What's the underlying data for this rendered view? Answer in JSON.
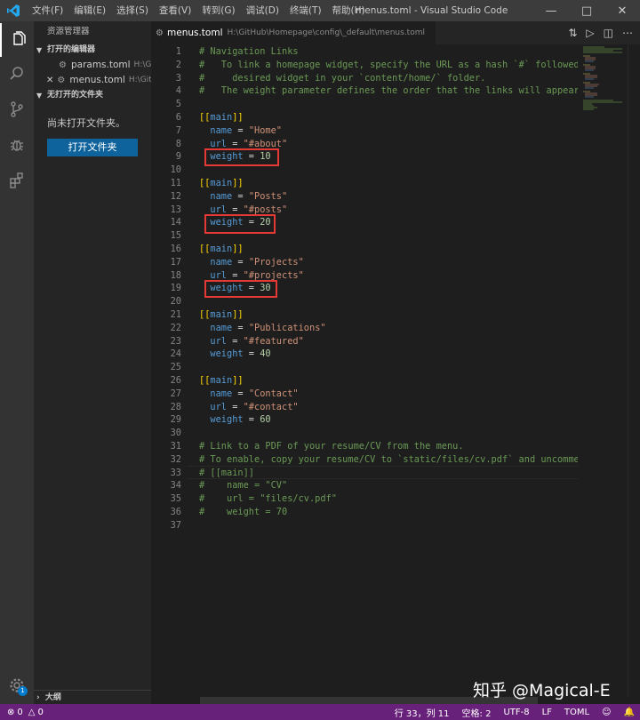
{
  "titlebar": {
    "menu": [
      "文件(F)",
      "编辑(E)",
      "选择(S)",
      "查看(V)",
      "转到(G)",
      "调试(D)",
      "终端(T)",
      "帮助(H)"
    ],
    "window_title": "menus.toml - Visual Studio Code"
  },
  "sidebar": {
    "title": "资源管理器",
    "open_editors_label": "打开的编辑器",
    "open_editors": [
      {
        "name": "params.toml",
        "path": "H:\\Gi..."
      },
      {
        "name": "menus.toml",
        "path": "H:\\Git..."
      }
    ],
    "no_folder_label": "无打开的文件夹",
    "no_folder_text": "尚未打开文件夹。",
    "open_folder_button": "打开文件夹",
    "outline_label": "大纲",
    "settings_badge": "1"
  },
  "editor": {
    "tab_name": "menus.toml",
    "tab_path": "H:\\GitHub\\Homepage\\config\\_default\\menus.toml",
    "lines": [
      {
        "n": "1",
        "tokens": [
          {
            "t": "# Navigation Links",
            "c": "comment"
          }
        ]
      },
      {
        "n": "2",
        "tokens": [
          {
            "t": "#   To link a homepage widget, specify the URL as a hash `#` followed b",
            "c": "comment"
          }
        ]
      },
      {
        "n": "3",
        "tokens": [
          {
            "t": "#     desired widget in your `content/home/` folder.",
            "c": "comment"
          }
        ]
      },
      {
        "n": "4",
        "tokens": [
          {
            "t": "#   The weight parameter defines the order that the links will appear i",
            "c": "comment"
          }
        ]
      },
      {
        "n": "5",
        "tokens": []
      },
      {
        "n": "6",
        "tokens": [
          {
            "t": "[[",
            "c": "bracket"
          },
          {
            "t": "main",
            "c": "key"
          },
          {
            "t": "]]",
            "c": "bracket"
          }
        ]
      },
      {
        "n": "7",
        "tokens": [
          {
            "t": "  name",
            "c": "key"
          },
          {
            "t": " = ",
            "c": "op"
          },
          {
            "t": "\"Home\"",
            "c": "str"
          }
        ]
      },
      {
        "n": "8",
        "tokens": [
          {
            "t": "  url",
            "c": "key"
          },
          {
            "t": " = ",
            "c": "op"
          },
          {
            "t": "\"#about\"",
            "c": "str"
          }
        ]
      },
      {
        "n": "9",
        "tokens": [
          {
            "t": "  weight",
            "c": "key"
          },
          {
            "t": " = ",
            "c": "op"
          },
          {
            "t": "10",
            "c": "num"
          }
        ]
      },
      {
        "n": "10",
        "tokens": []
      },
      {
        "n": "11",
        "tokens": [
          {
            "t": "[[",
            "c": "bracket"
          },
          {
            "t": "main",
            "c": "key"
          },
          {
            "t": "]]",
            "c": "bracket"
          }
        ]
      },
      {
        "n": "12",
        "tokens": [
          {
            "t": "  name",
            "c": "key"
          },
          {
            "t": " = ",
            "c": "op"
          },
          {
            "t": "\"Posts\"",
            "c": "str"
          }
        ]
      },
      {
        "n": "13",
        "tokens": [
          {
            "t": "  url",
            "c": "key"
          },
          {
            "t": " = ",
            "c": "op"
          },
          {
            "t": "\"#posts\"",
            "c": "str"
          }
        ]
      },
      {
        "n": "14",
        "tokens": [
          {
            "t": "  weight",
            "c": "key"
          },
          {
            "t": " = ",
            "c": "op"
          },
          {
            "t": "20",
            "c": "num"
          }
        ]
      },
      {
        "n": "15",
        "tokens": []
      },
      {
        "n": "16",
        "tokens": [
          {
            "t": "[[",
            "c": "bracket"
          },
          {
            "t": "main",
            "c": "key"
          },
          {
            "t": "]]",
            "c": "bracket"
          }
        ]
      },
      {
        "n": "17",
        "tokens": [
          {
            "t": "  name",
            "c": "key"
          },
          {
            "t": " = ",
            "c": "op"
          },
          {
            "t": "\"Projects\"",
            "c": "str"
          }
        ]
      },
      {
        "n": "18",
        "tokens": [
          {
            "t": "  url",
            "c": "key"
          },
          {
            "t": " = ",
            "c": "op"
          },
          {
            "t": "\"#projects\"",
            "c": "str"
          }
        ]
      },
      {
        "n": "19",
        "tokens": [
          {
            "t": "  weight",
            "c": "key"
          },
          {
            "t": " = ",
            "c": "op"
          },
          {
            "t": "30",
            "c": "num"
          }
        ]
      },
      {
        "n": "20",
        "tokens": []
      },
      {
        "n": "21",
        "tokens": [
          {
            "t": "[[",
            "c": "bracket"
          },
          {
            "t": "main",
            "c": "key"
          },
          {
            "t": "]]",
            "c": "bracket"
          }
        ]
      },
      {
        "n": "22",
        "tokens": [
          {
            "t": "  name",
            "c": "key"
          },
          {
            "t": " = ",
            "c": "op"
          },
          {
            "t": "\"Publications\"",
            "c": "str"
          }
        ]
      },
      {
        "n": "23",
        "tokens": [
          {
            "t": "  url",
            "c": "key"
          },
          {
            "t": " = ",
            "c": "op"
          },
          {
            "t": "\"#featured\"",
            "c": "str"
          }
        ]
      },
      {
        "n": "24",
        "tokens": [
          {
            "t": "  weight",
            "c": "key"
          },
          {
            "t": " = ",
            "c": "op"
          },
          {
            "t": "40",
            "c": "num"
          }
        ]
      },
      {
        "n": "25",
        "tokens": []
      },
      {
        "n": "26",
        "tokens": [
          {
            "t": "[[",
            "c": "bracket"
          },
          {
            "t": "main",
            "c": "key"
          },
          {
            "t": "]]",
            "c": "bracket"
          }
        ]
      },
      {
        "n": "27",
        "tokens": [
          {
            "t": "  name",
            "c": "key"
          },
          {
            "t": " = ",
            "c": "op"
          },
          {
            "t": "\"Contact\"",
            "c": "str"
          }
        ]
      },
      {
        "n": "28",
        "tokens": [
          {
            "t": "  url",
            "c": "key"
          },
          {
            "t": " = ",
            "c": "op"
          },
          {
            "t": "\"#contact\"",
            "c": "str"
          }
        ]
      },
      {
        "n": "29",
        "tokens": [
          {
            "t": "  weight",
            "c": "key"
          },
          {
            "t": " = ",
            "c": "op"
          },
          {
            "t": "60",
            "c": "num"
          }
        ]
      },
      {
        "n": "30",
        "tokens": []
      },
      {
        "n": "31",
        "tokens": [
          {
            "t": "# Link to a PDF of your resume/CV from the menu.",
            "c": "comment"
          }
        ]
      },
      {
        "n": "32",
        "tokens": [
          {
            "t": "# To enable, copy your resume/CV to `static/files/cv.pdf` and uncomment",
            "c": "comment"
          }
        ]
      },
      {
        "n": "33",
        "tokens": [
          {
            "t": "# [[main]]",
            "c": "comment"
          }
        ]
      },
      {
        "n": "34",
        "tokens": [
          {
            "t": "#    name = \"CV\"",
            "c": "comment"
          }
        ]
      },
      {
        "n": "35",
        "tokens": [
          {
            "t": "#    url = \"files/cv.pdf\"",
            "c": "comment"
          }
        ]
      },
      {
        "n": "36",
        "tokens": [
          {
            "t": "#    weight = 70",
            "c": "comment"
          }
        ]
      },
      {
        "n": "37",
        "tokens": []
      }
    ]
  },
  "statusbar": {
    "errors": "0",
    "warnings": "0",
    "position": "行 33，列 11",
    "spaces": "空格: 2",
    "encoding": "UTF-8",
    "eol": "LF",
    "language": "TOML"
  },
  "watermark": "知乎 @Magical-E",
  "colors": {
    "statusbar": "#68217a",
    "highlight_box": "#e53935",
    "button": "#0e639c"
  }
}
